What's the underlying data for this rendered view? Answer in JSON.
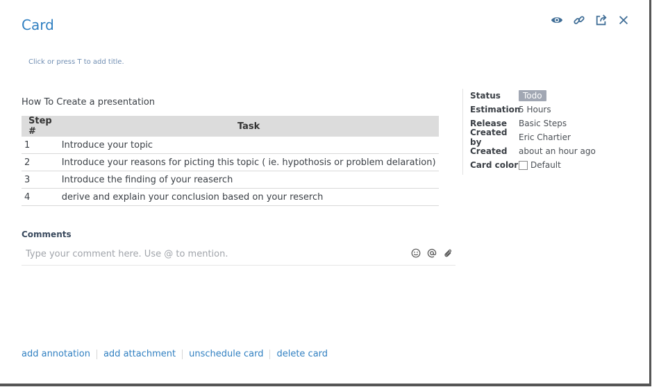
{
  "header": {
    "title": "Card",
    "icons": [
      "eye-icon",
      "link-icon",
      "share-icon",
      "close-icon"
    ]
  },
  "title_hint": "Click or press T to add title.",
  "description": "How To Create a presentation",
  "table": {
    "headers": [
      "Step #",
      "Task"
    ],
    "rows": [
      [
        "1",
        "Introduce your topic"
      ],
      [
        "2",
        "Introduce your reasons for picting this topic ( ie. hypothosis or problem delaration)"
      ],
      [
        "3",
        "Introduce the finding of your reaserch"
      ],
      [
        "4",
        "derive and explain your conclusion based on your reserch"
      ]
    ]
  },
  "meta": {
    "status_label": "Status",
    "status_value": "Todo",
    "status_color": "#a1a7b3",
    "estimation_label": "Estimation",
    "estimation_value": "5 Hours",
    "release_label": "Release",
    "release_value": "Basic Steps",
    "created_by_label": "Created by",
    "created_by_value": "Eric Chartier",
    "created_label": "Created",
    "created_value": "about an hour ago",
    "card_color_label": "Card color",
    "card_color_value": "Default"
  },
  "comments": {
    "label": "Comments",
    "placeholder": "Type your comment here. Use @ to mention.",
    "icons": [
      "smiley-icon",
      "at-icon",
      "paperclip-icon"
    ]
  },
  "actions": {
    "add_annotation": "add annotation",
    "add_attachment": "add attachment",
    "unschedule_card": "unschedule card",
    "delete_card": "delete card"
  },
  "colors": {
    "accent": "#2f7fc1",
    "table_header": "#dcdcdc"
  }
}
